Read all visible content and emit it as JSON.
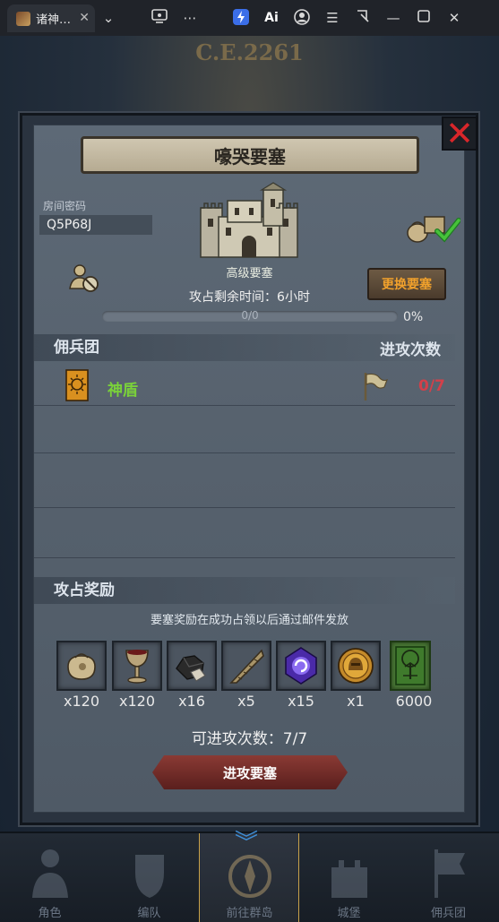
{
  "browser": {
    "tab_title": "诸神…",
    "tab_close": "✕",
    "icons": [
      "chevron-down-icon",
      "cast-icon",
      "more-icon",
      "bolt-icon",
      "ai-icon",
      "account-icon",
      "menu-icon",
      "crop-icon",
      "minimize-icon",
      "maximize-icon",
      "close-icon"
    ],
    "ai_label": "Ai"
  },
  "background": {
    "era": "C.E.2261"
  },
  "dialog": {
    "title": "嚎哭要塞",
    "room_label": "房间密码",
    "room_code": "Q5P68J",
    "fort_name": "高级要塞",
    "time_left": "攻占剩余时间：6小时",
    "progress": {
      "text": "0/0",
      "percent_label": "0%",
      "value": 0
    },
    "change_button": "更换要塞",
    "mercenary_header": "佣兵团",
    "attack_count_header": "进攻次数",
    "mercenary": {
      "name": "神盾",
      "attacks": "0/7"
    },
    "reward_header": "攻占奖励",
    "reward_note": "要塞奖励在成功占领以后通过邮件发放",
    "rewards": [
      {
        "icon": "sack-icon",
        "qty": "x120"
      },
      {
        "icon": "goblet-icon",
        "qty": "x120"
      },
      {
        "icon": "ore-icon",
        "qty": "x16"
      },
      {
        "icon": "horn-icon",
        "qty": "x5"
      },
      {
        "icon": "crystal-icon",
        "qty": "x15"
      },
      {
        "icon": "helmet-coin-icon",
        "qty": "x1"
      },
      {
        "icon": "tree-banner-icon",
        "qty": "6000"
      }
    ],
    "remaining_attacks": "可进攻次数：7/7",
    "attack_button": "进攻要塞",
    "close_glyph": "✕"
  },
  "nav": {
    "items": [
      {
        "label": "角色"
      },
      {
        "label": "编队"
      },
      {
        "label": "前往群岛"
      },
      {
        "label": "城堡"
      },
      {
        "label": "佣兵团"
      }
    ],
    "active_index": 2
  },
  "colors": {
    "merc_name": "#7ad13a",
    "attack_count": "#d2404a",
    "change_button_text": "#f1a12c",
    "close_x": "#d8262a"
  }
}
